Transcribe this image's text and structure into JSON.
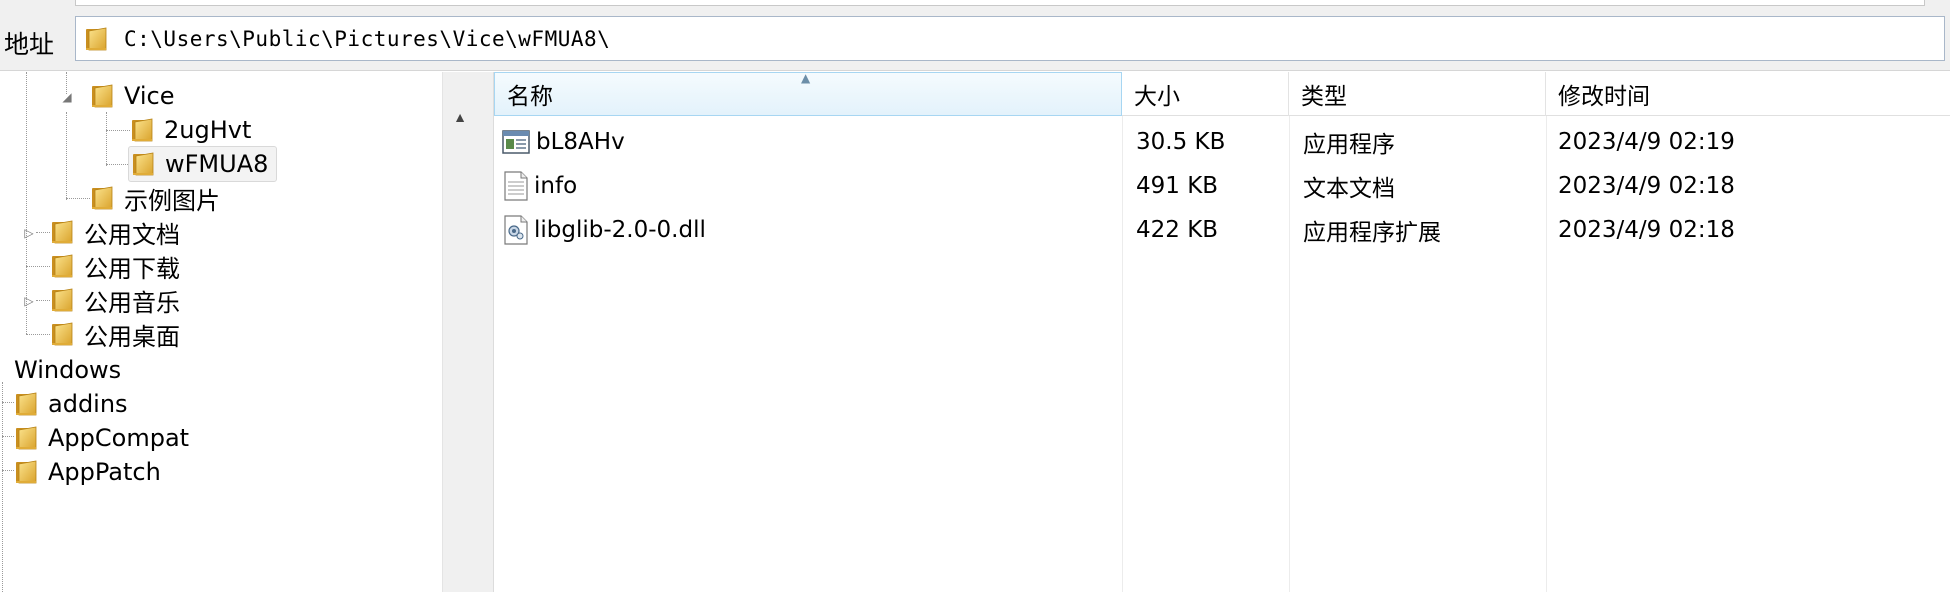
{
  "address": {
    "label": "地址",
    "path": "C:\\Users\\Public\\Pictures\\Vice\\wFMUA8\\"
  },
  "tree": {
    "items": [
      {
        "label": "Vice",
        "icon": "folder-icon",
        "expander": "expanded"
      },
      {
        "label": "2ugHvt",
        "icon": "folder-icon"
      },
      {
        "label": "wFMUA8",
        "icon": "folder-icon",
        "selected": true
      },
      {
        "label": "示例图片",
        "icon": "folder-icon"
      },
      {
        "label": "公用文档",
        "icon": "folder-icon",
        "expander": "collapsed"
      },
      {
        "label": "公用下载",
        "icon": "folder-icon"
      },
      {
        "label": "公用音乐",
        "icon": "folder-icon",
        "expander": "collapsed"
      },
      {
        "label": "公用桌面",
        "icon": "folder-icon"
      },
      {
        "label": "Windows",
        "icon": "none"
      },
      {
        "label": "addins",
        "icon": "folder-icon"
      },
      {
        "label": "AppCompat",
        "icon": "folder-icon"
      },
      {
        "label": "AppPatch",
        "icon": "folder-icon"
      }
    ]
  },
  "files": {
    "columns": [
      "名称",
      "大小",
      "类型",
      "修改时间"
    ],
    "sorted_column": "名称",
    "rows": [
      {
        "name": "bL8AHv",
        "size": "30.5 KB",
        "type": "应用程序",
        "modified": "2023/4/9 02:19",
        "icon": "application-icon"
      },
      {
        "name": "info",
        "size": "491 KB",
        "type": "文本文档",
        "modified": "2023/4/9 02:18",
        "icon": "text-document-icon"
      },
      {
        "name": "libglib-2.0-0.dll",
        "size": "422 KB",
        "type": "应用程序扩展",
        "modified": "2023/4/9 02:18",
        "icon": "dll-file-icon"
      }
    ]
  },
  "colors": {
    "folder": "#e8b84a",
    "selection_bg": "#f3f3f3",
    "header_sorted": "#e3f2fb"
  }
}
